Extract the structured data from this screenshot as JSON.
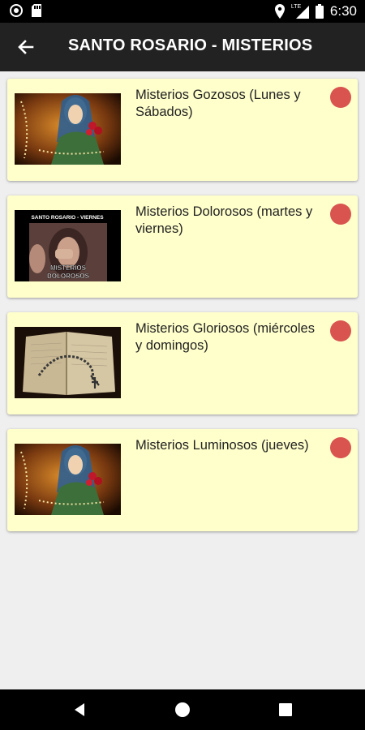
{
  "status_bar": {
    "time": "6:30",
    "network": "LTE",
    "icons": [
      "media-icon",
      "sd-card-icon",
      "location-icon",
      "signal-icon",
      "battery-icon"
    ]
  },
  "header": {
    "title": "SANTO ROSARIO - MISTERIOS",
    "back_icon": "arrow-back-icon",
    "background": "#222222"
  },
  "mysteries": [
    {
      "label": "Misterios Gozosos (Lunes y Sábados)",
      "thumb_icon": "virgin-mary-rosary-image"
    },
    {
      "label": "Misterios Dolorosos (martes y viernes)",
      "thumb_icon": "dolorosos-image",
      "thumb_top_text": "SANTO ROSARIO - VIERNES",
      "thumb_caption_line1": "MISTERIOS",
      "thumb_caption_line2": "DOLOROSOS"
    },
    {
      "label": "Misterios Gloriosos (miércoles y domingos)",
      "thumb_icon": "rosary-book-image"
    },
    {
      "label": "Misterios Luminosos (jueves)",
      "thumb_icon": "virgin-mary-rosary-image"
    }
  ],
  "colors": {
    "card_background": "#ffffcc",
    "accent_dot": "#d9534f",
    "page_background": "#efefef"
  },
  "nav_bar": {
    "icons": [
      "back-triangle-icon",
      "home-circle-icon",
      "recents-square-icon"
    ]
  }
}
